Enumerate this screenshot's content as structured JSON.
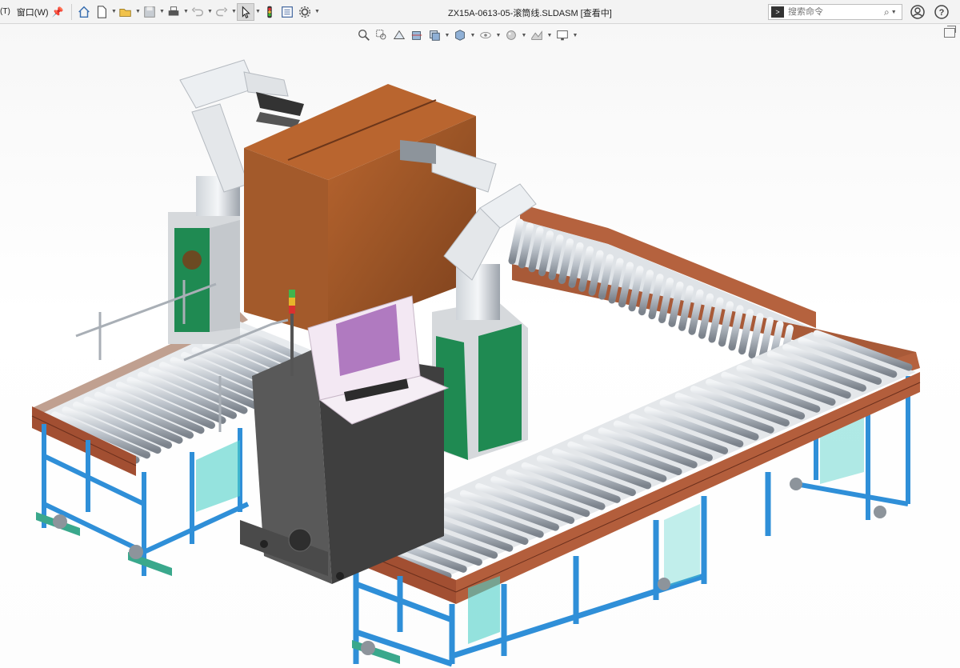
{
  "menu": {
    "fragment": "(T)",
    "window_label": "窗口(W)"
  },
  "toolbar": {
    "tools": [
      {
        "name": "home-icon",
        "dropdown": false
      },
      {
        "name": "new-document-icon",
        "dropdown": true
      },
      {
        "name": "open-folder-icon",
        "dropdown": true
      },
      {
        "name": "save-icon",
        "dropdown": true
      },
      {
        "name": "print-icon",
        "dropdown": true
      },
      {
        "name": "undo-icon",
        "dropdown": true
      },
      {
        "name": "redo-icon",
        "dropdown": true
      },
      {
        "name": "select-cursor-icon",
        "dropdown": true
      },
      {
        "name": "traffic-light-icon",
        "dropdown": false
      },
      {
        "name": "file-properties-icon",
        "dropdown": false
      },
      {
        "name": "gear-icon",
        "dropdown": true
      }
    ]
  },
  "document": {
    "title": "ZX15A-0613-05-滚筒线.SLDASM [查看中]"
  },
  "search": {
    "placeholder": "搜索命令"
  },
  "heads_up_toolbar": {
    "tools": [
      "zoom-to-fit-icon",
      "zoom-area-icon",
      "previous-view-icon",
      "section-view-icon",
      "view-orientation-icon",
      "display-style-icon",
      "hide-show-items-icon",
      "edit-appearance-icon",
      "apply-scene-icon",
      "view-settings-icon"
    ]
  },
  "colors": {
    "frame_blue": "#2f8fd8",
    "roller_gray": "#c9cfd6",
    "rail_copper": "#b5623e",
    "box_brown": "#9a5426",
    "cabinet_green": "#1f8a52",
    "console_dark": "#4a4a4a",
    "screen_magenta": "#b07ac0",
    "robot_white": "#e9ecef",
    "teal_panel": "#4fd1c8"
  }
}
